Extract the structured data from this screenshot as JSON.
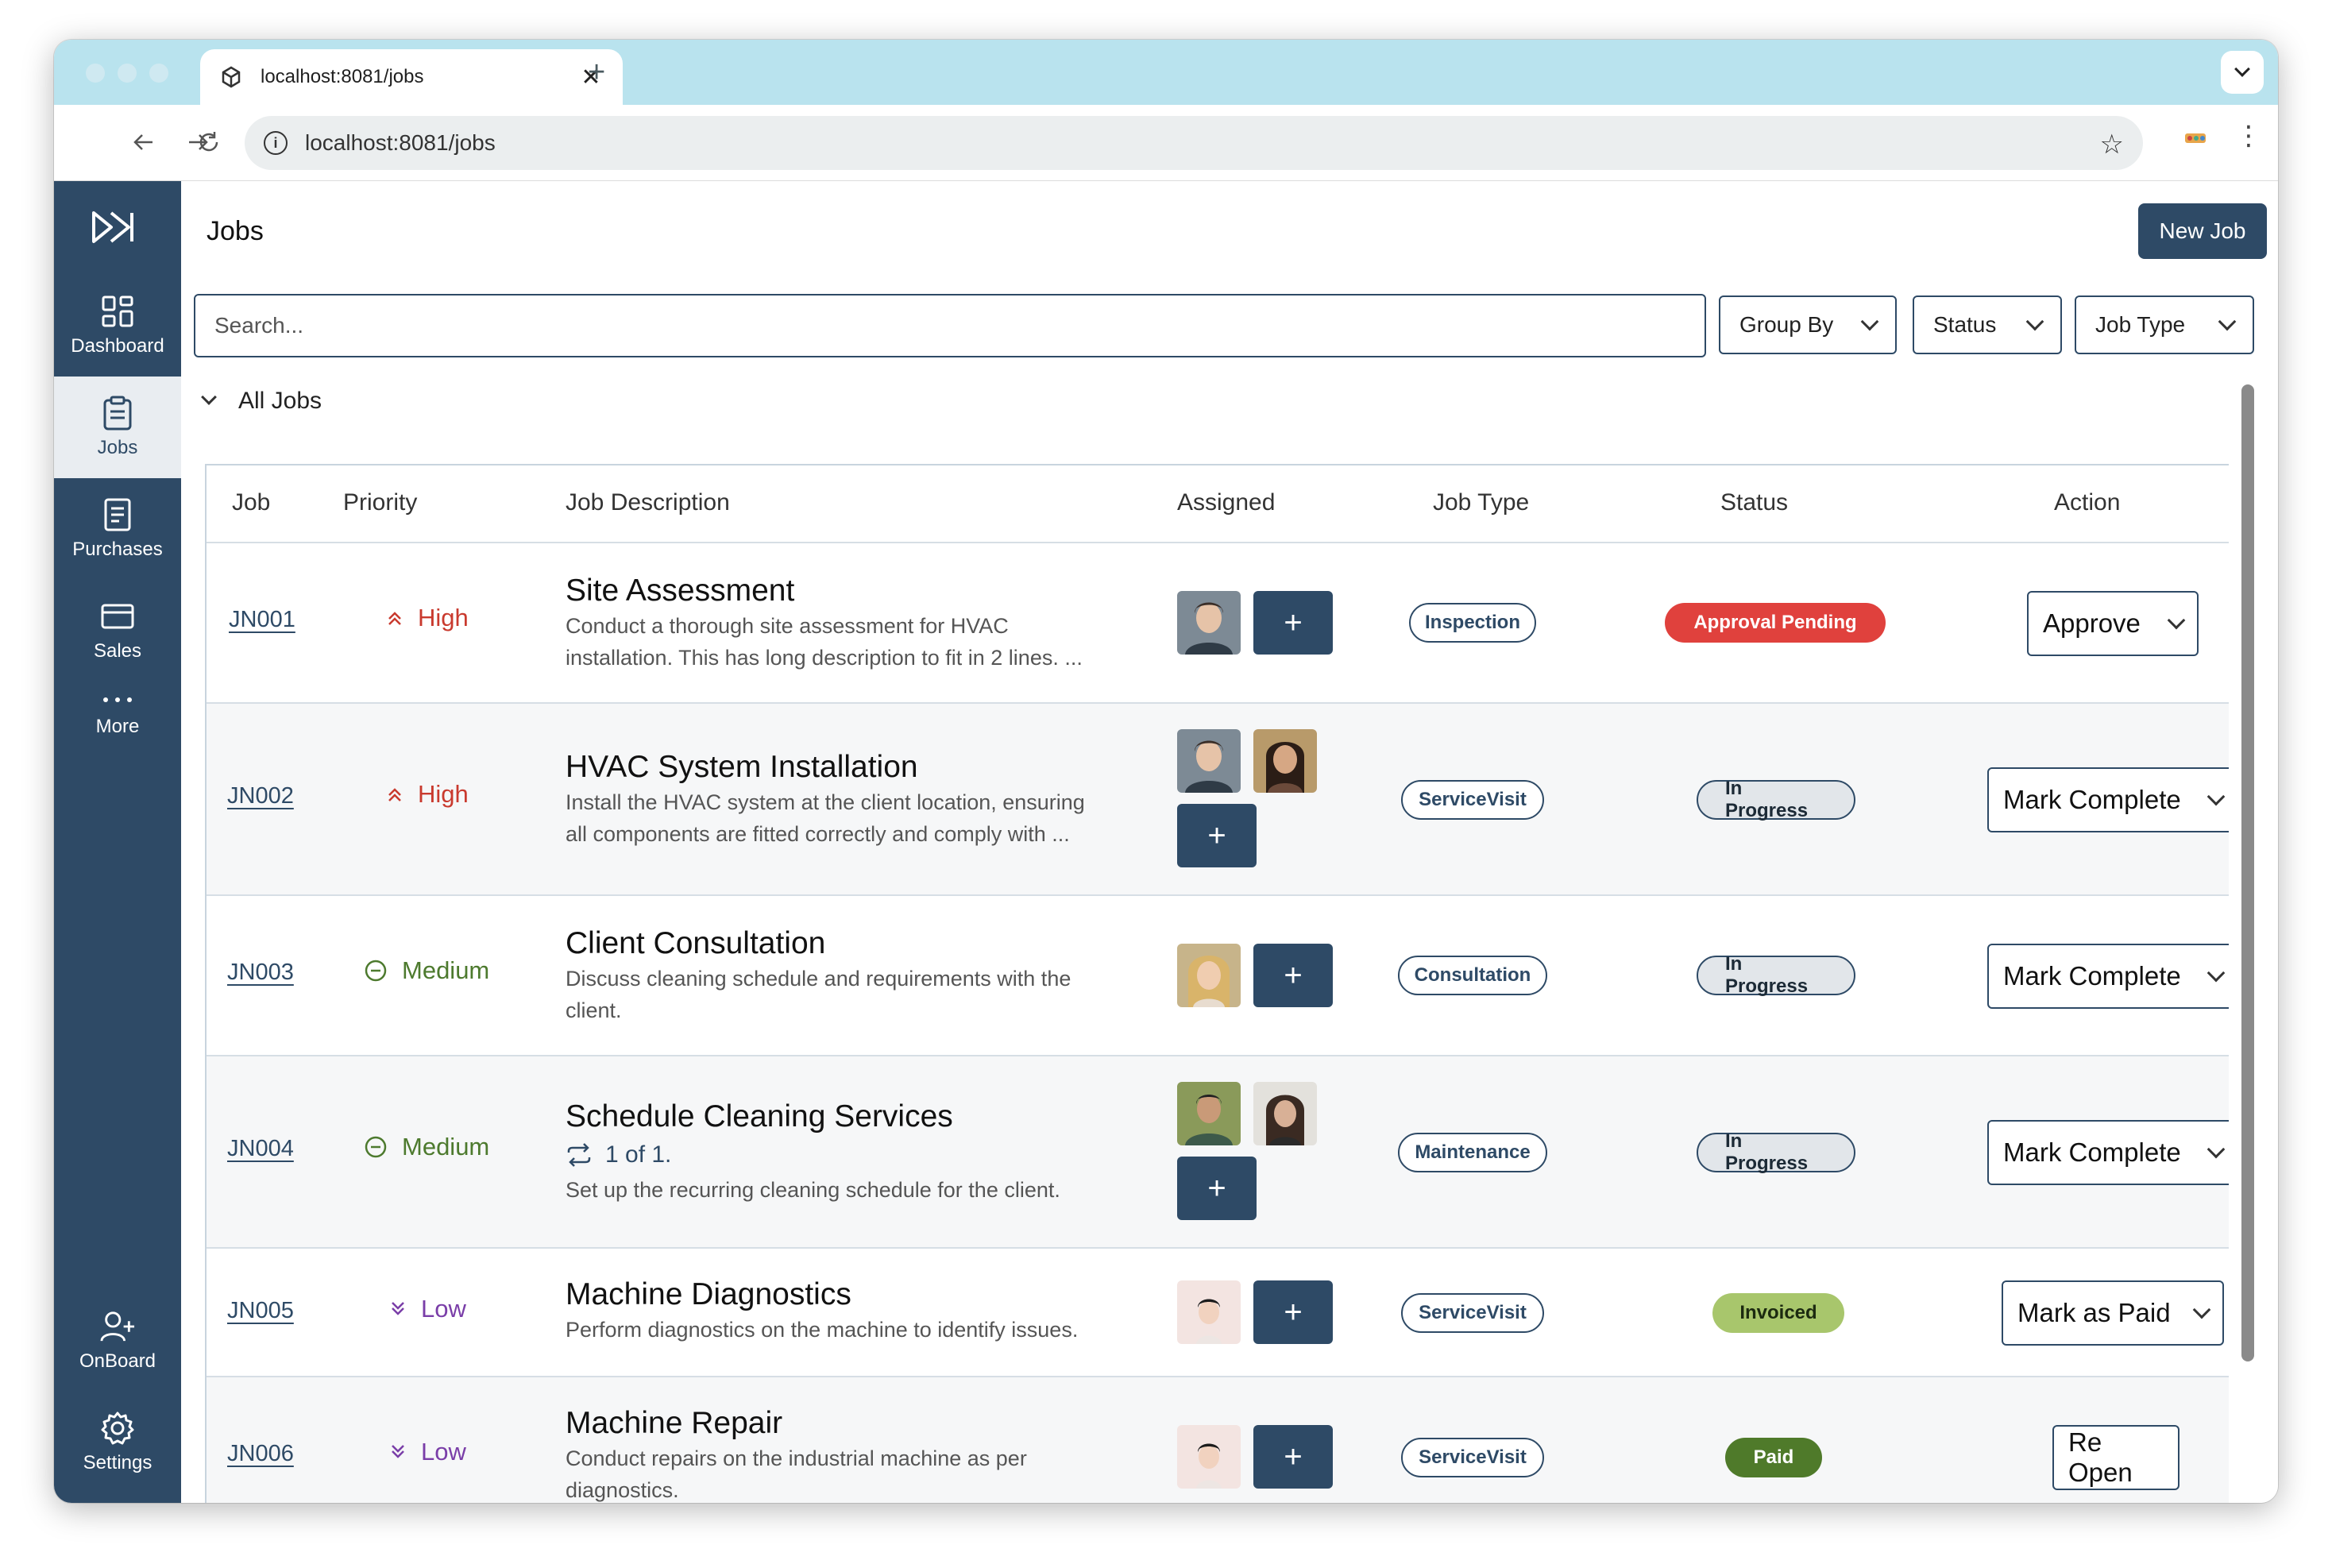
{
  "browser": {
    "tab_title": "localhost:8081/jobs",
    "tab_close": "✕",
    "new_tab": "+",
    "url": "localhost:8081/jobs"
  },
  "sidebar": {
    "items": [
      {
        "label": "Dashboard",
        "icon": "dashboard-icon"
      },
      {
        "label": "Jobs",
        "icon": "clipboard-icon"
      },
      {
        "label": "Purchases",
        "icon": "document-icon"
      },
      {
        "label": "Sales",
        "icon": "card-icon"
      },
      {
        "label": "More",
        "icon": "more-icon"
      },
      {
        "label": "OnBoard",
        "icon": "user-plus-icon"
      },
      {
        "label": "Settings",
        "icon": "gear-icon"
      }
    ]
  },
  "header": {
    "title": "Jobs",
    "new_job_label": "New Job"
  },
  "filters": {
    "search_placeholder": "Search...",
    "group_by": "Group By",
    "status": "Status",
    "job_type": "Job Type"
  },
  "group": {
    "label": "All Jobs"
  },
  "table": {
    "columns": [
      "Job",
      "Priority",
      "Job Description",
      "Assigned",
      "Job Type",
      "Status",
      "Action"
    ],
    "rows": [
      {
        "job": "JN001",
        "priority": "High",
        "title": "Site Assessment",
        "desc1": "Conduct a thorough site assessment for HVAC",
        "desc2": "installation. This has long description to fit in 2 lines. ...",
        "type": "Inspection",
        "status": "Approval Pending",
        "action": "Approve"
      },
      {
        "job": "JN002",
        "priority": "High",
        "title": "HVAC System Installation",
        "desc1": "Install the HVAC system at the client location, ensuring",
        "desc2": "all components are fitted correctly and comply with ...",
        "type": "ServiceVisit",
        "status": "In Progress",
        "action": "Mark Complete"
      },
      {
        "job": "JN003",
        "priority": "Medium",
        "title": "Client Consultation",
        "desc1": "Discuss cleaning schedule and requirements with the",
        "desc2": "client.",
        "type": "Consultation",
        "status": "In Progress",
        "action": "Mark Complete"
      },
      {
        "job": "JN004",
        "priority": "Medium",
        "title": "Schedule Cleaning Services",
        "recurrence": "1 of 1.",
        "desc1": "Set up the recurring cleaning schedule for the client.",
        "desc2": "",
        "type": "Maintenance",
        "status": "In Progress",
        "action": "Mark Complete"
      },
      {
        "job": "JN005",
        "priority": "Low",
        "title": "Machine Diagnostics",
        "desc1": "Perform diagnostics on the machine to identify issues.",
        "desc2": "",
        "type": "ServiceVisit",
        "status": "Invoiced",
        "action": "Mark as Paid"
      },
      {
        "job": "JN006",
        "priority": "Low",
        "title": "Machine Repair",
        "desc1": "Conduct repairs on the industrial machine as per",
        "desc2": "diagnostics.",
        "type": "ServiceVisit",
        "status": "Paid",
        "action": "Re Open"
      }
    ]
  },
  "colors": {
    "primary": "#2e4a66",
    "status_approval_pending": "#e0413d",
    "status_in_progress": "#e2e6ea",
    "status_invoiced": "#a8c66c",
    "status_paid": "#4f7a2a",
    "priority_high": "#c93a2e",
    "priority_medium": "#4d7a2e",
    "priority_low": "#7a3ea8"
  }
}
